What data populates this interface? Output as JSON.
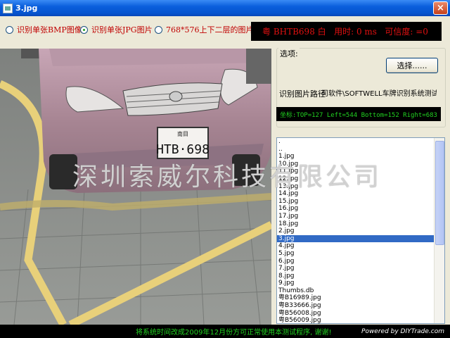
{
  "window": {
    "title": "3.jpg",
    "close_glyph": "×"
  },
  "options": {
    "radio1_label": "识别单张BMP图像",
    "radio2_label": "识别单张JPG图片",
    "radio3_label": "768*576上下二层的图片",
    "selected": "radio2"
  },
  "result": {
    "text": "粤 BHTB698 白   用时: 0 ms   可信度: =0"
  },
  "photo": {
    "plate_top": "南目",
    "plate_number": "HTB·698"
  },
  "settings": {
    "group_label": "选项:",
    "select_button": "选择......",
    "path_label": "识别图片路径",
    "path_value": "司软件\\SOFTWELL车牌识别系统测试版\\车牌",
    "coords": "坐标:TOP=127 Left=544 Bottom=152 Right=683"
  },
  "file_list": {
    "items": [
      ".",
      "..",
      "1.jpg",
      "10.jpg",
      "11.jpg",
      "12.jpg",
      "13.jpg",
      "14.jpg",
      "15.jpg",
      "16.jpg",
      "17.jpg",
      "18.jpg",
      "2.jpg",
      "3.jpg",
      "4.jpg",
      "5.jpg",
      "6.jpg",
      "7.jpg",
      "8.jpg",
      "9.jpg",
      "Thumbs.db",
      "粤B16989.jpg",
      "粤B33666.jpg",
      "粤B56008.jpg",
      "粤B56009.jpg"
    ],
    "selected_index": 13
  },
  "status": {
    "notice": "将系统时间改成2009年12月份方可正常使用本测试程序, 谢谢!",
    "powered_by": "Powered by DIYTrade.com"
  },
  "watermark": "深圳索威尔科技有限公司",
  "colors": {
    "title_blue": "#0a5fdc",
    "result_red": "#e01010",
    "coord_green": "#21d021",
    "selection_blue": "#316ac5"
  }
}
